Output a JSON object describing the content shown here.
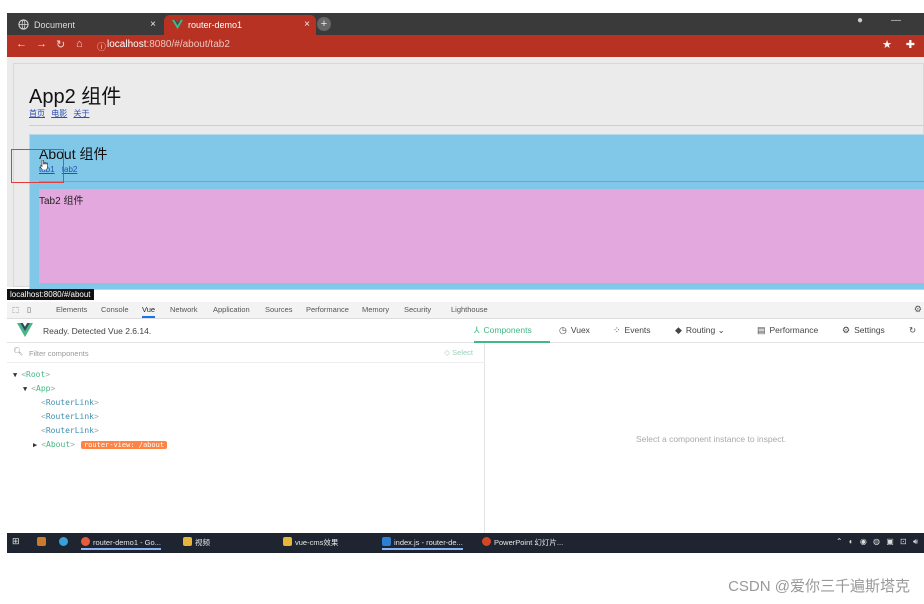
{
  "browser": {
    "tabs": [
      {
        "title": "Document",
        "close": "×"
      },
      {
        "title": "router-demo1",
        "close": "×"
      }
    ],
    "new_tab": "+",
    "url_host": "localhost",
    "url_path": ":8080/#/about/tab2",
    "icons": [
      "back-arrow-icon",
      "forward-arrow-icon",
      "reload-icon",
      "home-icon",
      "info-icon",
      "star-icon",
      "extensions-icon"
    ]
  },
  "page": {
    "app_title": "App2 组件",
    "app_links": [
      "首页",
      "电影",
      "关于"
    ],
    "about_title": "About 组件",
    "about_links": [
      "tab1",
      "tab2"
    ],
    "tab2_title": "Tab2 组件",
    "status_url": "localhost:8080/#/about",
    "colors": {
      "about_bg": "#80c7e8",
      "tab2_bg": "#e3a9de"
    }
  },
  "devtools": {
    "tabs": [
      "Elements",
      "Console",
      "Vue",
      "Network",
      "Application",
      "Sources",
      "Performance",
      "Memory",
      "Security",
      "Lighthouse"
    ],
    "selected_tab": "Vue",
    "vue": {
      "status": "Ready. Detected Vue 2.6.14.",
      "nav": [
        "Components",
        "Vuex",
        "Events",
        "Routing",
        "Performance",
        "Settings"
      ],
      "active_nav": "Components",
      "filter_placeholder": "Filter components",
      "select_label": "Select",
      "tree": [
        {
          "name": "Root",
          "arrow": "▼"
        },
        {
          "name": "App",
          "arrow": "▼"
        },
        {
          "name": "RouterLink",
          "arrow": ""
        },
        {
          "name": "RouterLink",
          "arrow": ""
        },
        {
          "name": "RouterLink",
          "arrow": ""
        },
        {
          "name": "About",
          "arrow": "▶",
          "badge": "router-view: /about"
        }
      ],
      "inspect_hint": "Select a component instance to inspect."
    }
  },
  "taskbar": {
    "items": [
      "router-demo1 - Go...",
      "视频",
      "vue-cms效果",
      "index.js - router-de...",
      "PowerPoint 幻灯片..."
    ]
  },
  "watermark": "CSDN @爱你三千遍斯塔克"
}
